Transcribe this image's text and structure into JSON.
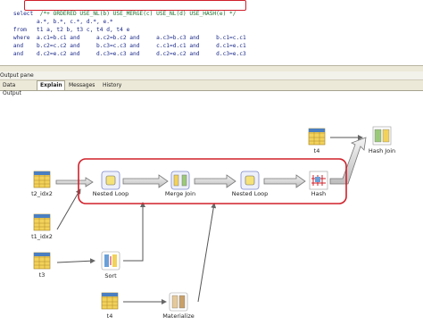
{
  "editor": {
    "lines": [
      {
        "kw": "select",
        "rest": "  /*+ ORDERED USE_NL(b) USE_MERGE(c) USE_NL(d) USE_HASH(e) */"
      },
      {
        "kw": "",
        "rest": "       a.*, b.*, c.*, d.*, e.*"
      },
      {
        "kw": "from",
        "rest": "   t1 a, t2 b, t3 c, t4 d, t4 e"
      },
      {
        "kw": "where",
        "rest": "  a.c1=b.c1 and     a.c2=b.c2 and     a.c3=b.c3 and     b.c1=c.c1"
      },
      {
        "kw": "and",
        "rest": "    b.c2=c.c2 and     b.c3=c.c3 and     c.c1=d.c1 and     d.c1=e.c1"
      },
      {
        "kw": "and",
        "rest": "    d.c2=e.c2 and     d.c3=e.c3 and     d.c2=e.c2 and     d.c3=e.c3"
      }
    ]
  },
  "output_pane": {
    "title": "Output pane",
    "tabs": [
      {
        "label": "Data Output",
        "active": false
      },
      {
        "label": "Explain",
        "active": true
      },
      {
        "label": "Messages",
        "active": false
      },
      {
        "label": "History",
        "active": false
      }
    ]
  },
  "plan": {
    "highlight_color": "#d0202a",
    "nodes": {
      "t2": "t2_idx2",
      "t1": "t1_idx2",
      "t3": "t3",
      "t4_bottom": "t4",
      "nested_loop_1": "Nested Loop",
      "merge_join": "Merge Join",
      "nested_loop_2": "Nested Loop",
      "hash": "Hash",
      "sort": "Sort",
      "materialize": "Materialize",
      "t4_top": "t4",
      "hash_join": "Hash Join"
    }
  }
}
